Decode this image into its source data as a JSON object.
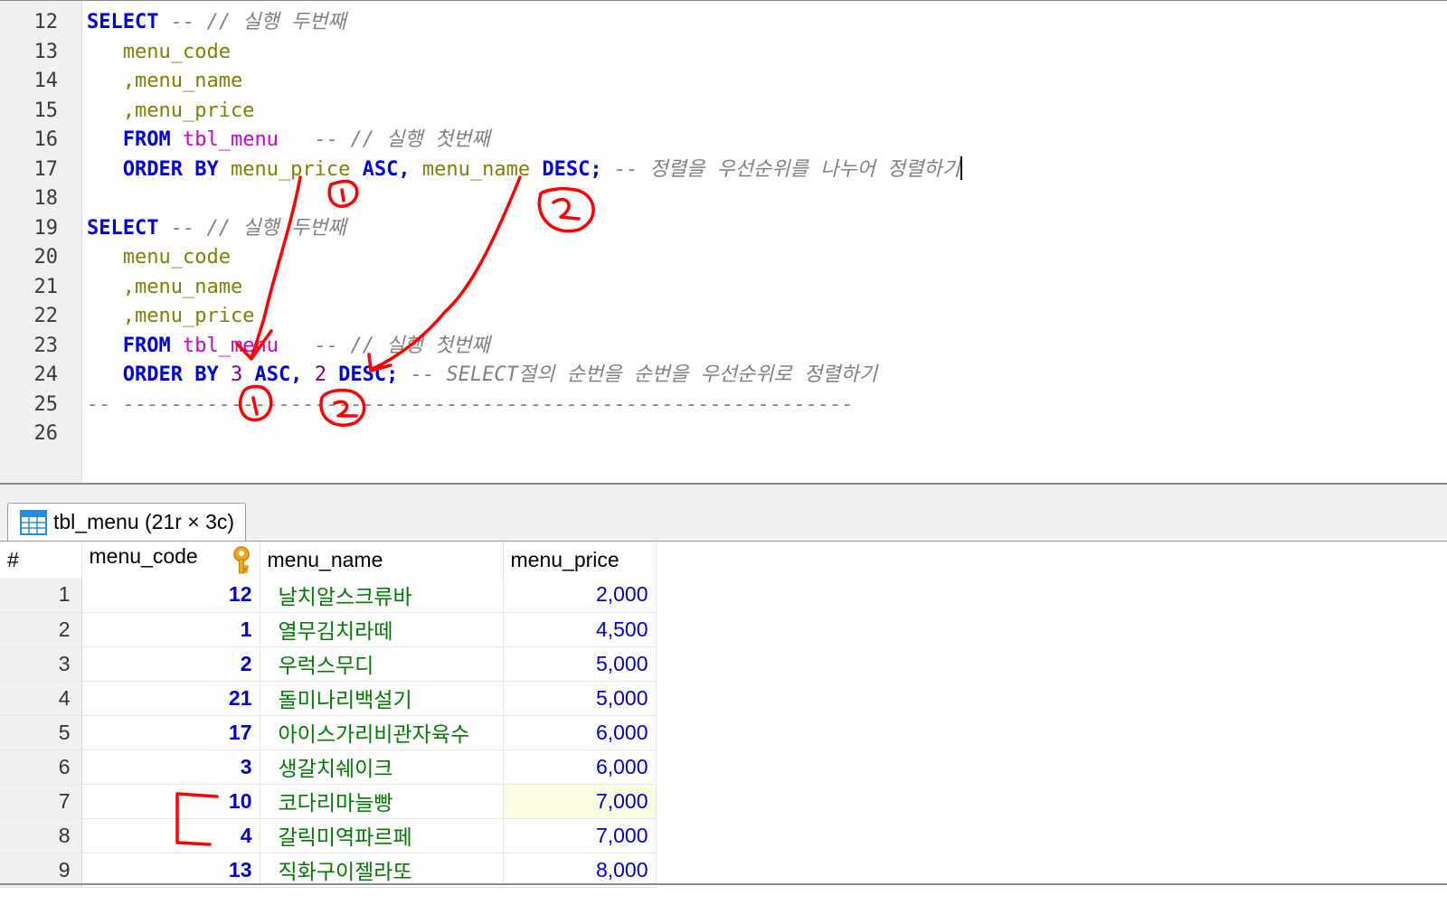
{
  "editor": {
    "lines": [
      {
        "n": "12",
        "tokens": [
          {
            "t": "SELECT",
            "c": "kw"
          },
          {
            "t": " -- // 실행 두번째",
            "c": "cm"
          }
        ]
      },
      {
        "n": "13",
        "tokens": [
          {
            "t": "   menu_code",
            "c": "id"
          }
        ]
      },
      {
        "n": "14",
        "tokens": [
          {
            "t": "   ,menu_name",
            "c": "id"
          }
        ]
      },
      {
        "n": "15",
        "tokens": [
          {
            "t": "   ,menu_price",
            "c": "id"
          }
        ]
      },
      {
        "n": "16",
        "tokens": [
          {
            "t": "   FROM",
            "c": "kw"
          },
          {
            "t": " "
          },
          {
            "t": "tbl_menu",
            "c": "tb"
          },
          {
            "t": "   -- // 실행 첫번째",
            "c": "cm"
          }
        ]
      },
      {
        "n": "17",
        "tokens": [
          {
            "t": "   ORDER BY",
            "c": "kw"
          },
          {
            "t": " menu_price",
            "c": "id"
          },
          {
            "t": " ASC,",
            "c": "kw"
          },
          {
            "t": " menu_name",
            "c": "id"
          },
          {
            "t": " DESC;",
            "c": "kw"
          },
          {
            "t": " -- 정렬을 우선순위를 나누어 정렬하기",
            "c": "cm"
          },
          {
            "caret": true
          }
        ]
      },
      {
        "n": "18",
        "tokens": []
      },
      {
        "n": "19",
        "tokens": [
          {
            "t": "SELECT",
            "c": "kw"
          },
          {
            "t": " -- // 실행 두번째",
            "c": "cm"
          }
        ]
      },
      {
        "n": "20",
        "tokens": [
          {
            "t": "   menu_code",
            "c": "id"
          }
        ]
      },
      {
        "n": "21",
        "tokens": [
          {
            "t": "   ,menu_name",
            "c": "id"
          }
        ]
      },
      {
        "n": "22",
        "tokens": [
          {
            "t": "   ,menu_price",
            "c": "id"
          }
        ]
      },
      {
        "n": "23",
        "tokens": [
          {
            "t": "   FROM",
            "c": "kw"
          },
          {
            "t": " "
          },
          {
            "t": "tbl_menu",
            "c": "tb"
          },
          {
            "t": "   -- // 실행 첫번째",
            "c": "cm"
          }
        ]
      },
      {
        "n": "24",
        "tokens": [
          {
            "t": "   ORDER BY",
            "c": "kw"
          },
          {
            "t": " "
          },
          {
            "t": "3",
            "c": "num"
          },
          {
            "t": " ASC,",
            "c": "kw"
          },
          {
            "t": " "
          },
          {
            "t": "2",
            "c": "num"
          },
          {
            "t": " DESC;",
            "c": "kw"
          },
          {
            "t": " -- SELECT절의 순번을 순번을 우선순위로 정렬하기",
            "c": "cm"
          }
        ]
      },
      {
        "n": "25",
        "tokens": [
          {
            "t": "-- -------------------------------------------------------------",
            "c": "cm"
          }
        ]
      },
      {
        "n": "26",
        "tokens": []
      }
    ]
  },
  "result_tab": {
    "label": "tbl_menu (21r × 3c)",
    "icon": "table-grid-icon"
  },
  "grid": {
    "columns": [
      "#",
      "menu_code",
      "menu_name",
      "menu_price"
    ],
    "key_icon": "primary-key-icon",
    "rows": [
      {
        "num": "1",
        "code": "12",
        "name": "날치알스크류바",
        "price": "2,000"
      },
      {
        "num": "2",
        "code": "1",
        "name": "열무김치라떼",
        "price": "4,500"
      },
      {
        "num": "3",
        "code": "2",
        "name": "우럭스무디",
        "price": "5,000"
      },
      {
        "num": "4",
        "code": "21",
        "name": "돌미나리백설기",
        "price": "5,000"
      },
      {
        "num": "5",
        "code": "17",
        "name": "아이스가리비관자육수",
        "price": "6,000"
      },
      {
        "num": "6",
        "code": "3",
        "name": "생갈치쉐이크",
        "price": "6,000"
      },
      {
        "num": "7",
        "code": "10",
        "name": "코다리마늘빵",
        "price": "7,000"
      },
      {
        "num": "8",
        "code": "4",
        "name": "갈릭미역파르페",
        "price": "7,000"
      },
      {
        "num": "9",
        "code": "13",
        "name": "직화구이젤라또",
        "price": "8,000"
      }
    ],
    "selected_row": 6
  },
  "annotations": {
    "marks": [
      "1",
      "2",
      "1",
      "2"
    ],
    "color": "#ff0000"
  }
}
